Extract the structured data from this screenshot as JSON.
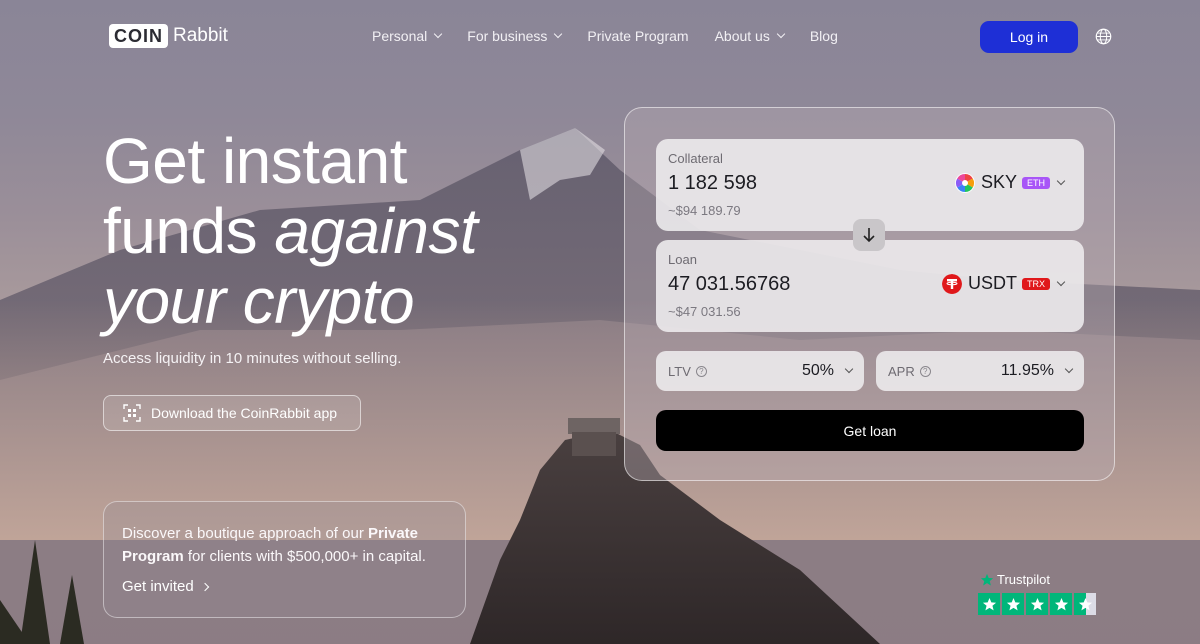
{
  "brand": {
    "logo_box": "COIN",
    "logo_text": "Rabbit"
  },
  "nav": {
    "items": [
      {
        "label": "Personal",
        "dropdown": true
      },
      {
        "label": "For business",
        "dropdown": true
      },
      {
        "label": "Private Program",
        "dropdown": false
      },
      {
        "label": "About us",
        "dropdown": true
      },
      {
        "label": "Blog",
        "dropdown": false
      }
    ],
    "login_label": "Log in",
    "login_color": "#1e2fd6"
  },
  "hero": {
    "title_line1": "Get instant",
    "title_line2_normal": "funds",
    "title_line2_italic": "against",
    "title_line3_italic": "your crypto",
    "subtitle": "Access liquidity in 10 minutes without selling.",
    "download_label": "Download the CoinRabbit app"
  },
  "private_program": {
    "text_before": "Discover a boutique approach of our ",
    "text_bold": "Private Program",
    "text_after": " for clients with $500,000+ in capital.",
    "link_label": "Get invited"
  },
  "calculator": {
    "collateral": {
      "label": "Collateral",
      "amount": "1 182 598",
      "usd": "~$94 189.79",
      "coin": "SKY",
      "network": "ETH",
      "network_color": "#a855f7"
    },
    "loan": {
      "label": "Loan",
      "amount": "47 031.56768",
      "usd": "~$47 031.56",
      "coin": "USDT",
      "network": "TRX",
      "network_color": "#e0181b"
    },
    "ltv": {
      "label": "LTV",
      "value": "50%"
    },
    "apr": {
      "label": "APR",
      "value": "11.95%"
    },
    "cta": "Get loan"
  },
  "trustpilot": {
    "label": "Trustpilot",
    "rating": 4.5,
    "star_color": "#00b67a"
  }
}
